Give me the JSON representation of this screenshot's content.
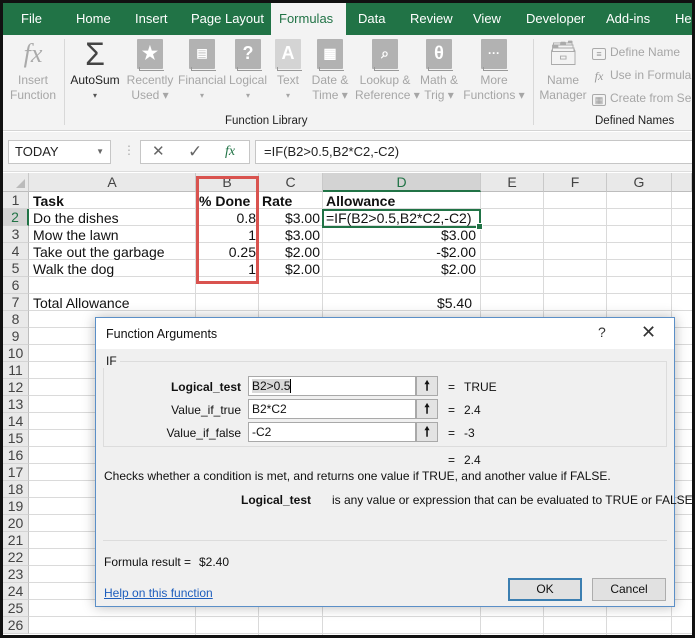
{
  "ribbon": {
    "tabs": [
      {
        "label": "File"
      },
      {
        "label": "Home"
      },
      {
        "label": "Insert"
      },
      {
        "label": "Page Layout"
      },
      {
        "label": "Formulas",
        "active": true
      },
      {
        "label": "Data"
      },
      {
        "label": "Review"
      },
      {
        "label": "View"
      },
      {
        "label": "Developer"
      },
      {
        "label": "Add-ins"
      },
      {
        "label": "Hel"
      }
    ],
    "function_library": {
      "group_label": "Function Library",
      "insert_function": {
        "line1": "Insert",
        "line2": "Function",
        "icon": "fx-icon"
      },
      "autosum": {
        "line1": "AutoSum",
        "line2": "▾",
        "icon": "sigma-icon"
      },
      "recently_used": {
        "line1": "Recently",
        "line2": "Used ▾",
        "icon": "star-book-icon"
      },
      "financial": {
        "line1": "Financial",
        "line2": "▾",
        "icon": "coins-book-icon"
      },
      "logical": {
        "line1": "Logical",
        "line2": "▾",
        "icon": "question-book-icon"
      },
      "text": {
        "line1": "Text",
        "line2": "▾",
        "icon": "a-book-icon"
      },
      "date_time": {
        "line1": "Date &",
        "line2": "Time ▾",
        "icon": "calendar-book-icon"
      },
      "lookup": {
        "line1": "Lookup &",
        "line2": "Reference ▾",
        "icon": "magnifier-book-icon"
      },
      "math": {
        "line1": "Math &",
        "line2": "Trig ▾",
        "icon": "theta-book-icon"
      },
      "more": {
        "line1": "More",
        "line2": "Functions ▾",
        "icon": "ellipsis-book-icon"
      }
    },
    "defined_names": {
      "group_label": "Defined Names",
      "name_manager": {
        "line1": "Name",
        "line2": "Manager"
      },
      "define_name": "Define Name",
      "use_in_formula": "Use in Formula",
      "create_from_selection": "Create from Sel"
    }
  },
  "formula_bar": {
    "name_box": "TODAY",
    "cancel_glyph": "✕",
    "enter_glyph": "✓",
    "fx_glyph": "fx",
    "formula": "=IF(B2>0.5,B2*C2,-C2)"
  },
  "sheet": {
    "columns": [
      "A",
      "B",
      "C",
      "D",
      "E",
      "F",
      "G"
    ],
    "rows": [
      "1",
      "2",
      "3",
      "4",
      "5",
      "6",
      "7",
      "8",
      "9",
      "10",
      "11",
      "12",
      "13",
      "14",
      "15",
      "16",
      "17",
      "18",
      "19",
      "20",
      "21",
      "22",
      "23",
      "24",
      "25",
      "26"
    ],
    "headers": {
      "task": "Task",
      "done": "% Done",
      "rate": "Rate",
      "allowance": "Allowance"
    },
    "data": [
      {
        "task": "Do the dishes",
        "done": "0.8",
        "rate": "$3.00",
        "allowance": "=IF(B2>0.5,B2*C2,-C2)"
      },
      {
        "task": "Mow the lawn",
        "done": "1",
        "rate": "$3.00",
        "allowance": "$3.00"
      },
      {
        "task": "Take out the garbage",
        "done": "0.25",
        "rate": "$2.00",
        "allowance": "-$2.00"
      },
      {
        "task": "Walk the dog",
        "done": "1",
        "rate": "$2.00",
        "allowance": "$2.00"
      }
    ],
    "total_label": "Total Allowance",
    "total_value": "$5.40",
    "active_cell": "D2",
    "highlight_color": "#d9534f"
  },
  "dialog": {
    "title": "Function Arguments",
    "help_glyph": "?",
    "close_glyph": "✕",
    "function_name": "IF",
    "args": [
      {
        "label": "Logical_test",
        "value": "B2>0.5",
        "result": "TRUE",
        "bold": true
      },
      {
        "label": "Value_if_true",
        "value": "B2*C2",
        "result": "2.4"
      },
      {
        "label": "Value_if_false",
        "value": "-C2",
        "result": "-3"
      }
    ],
    "ref_glyph": "🠕",
    "eq": "=",
    "overall_result": "2.4",
    "description": "Checks whether a condition is met, and returns one value if TRUE, and another value if FALSE.",
    "arg_help_name": "Logical_test",
    "arg_help_text": "is any value or expression that can be evaluated to TRUE or FALSE.",
    "formula_result_label": "Formula result =",
    "formula_result_value": "$2.40",
    "help_link": "Help on this function",
    "ok_label": "OK",
    "cancel_label": "Cancel"
  }
}
